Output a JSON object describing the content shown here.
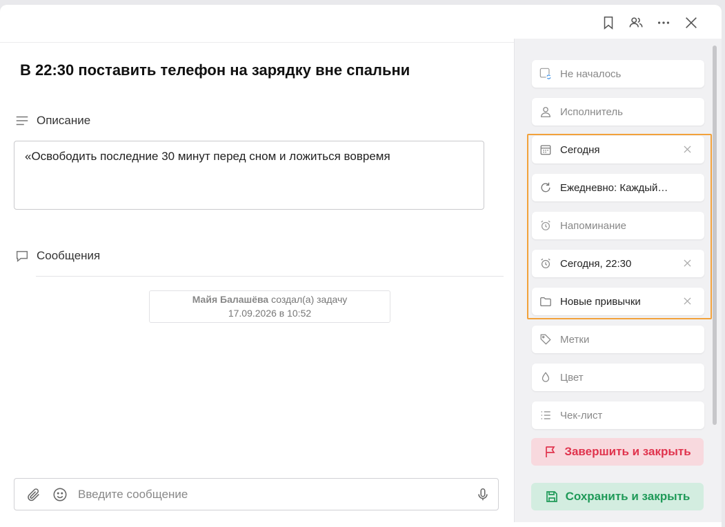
{
  "task": {
    "title": "В 22:30 поставить телефон на зарядку вне спальни"
  },
  "description": {
    "label": "Описание",
    "text": "«Освободить последние 30 минут перед сном и ложиться вовремя"
  },
  "messages": {
    "label": "Сообщения",
    "system_author": "Майя Балашёва",
    "system_action": "создал(а) задачу",
    "system_time": "17.09.2026 в 10:52",
    "input_placeholder": "Введите сообщение"
  },
  "sidebar": {
    "status": "Не началось",
    "assignee": "Исполнитель",
    "date": "Сегодня",
    "repeat": "Ежедневно: Каждый…",
    "reminder": "Напоминание",
    "reminder_set": "Сегодня, 22:30",
    "project": "Новые привычки",
    "tags": "Метки",
    "color": "Цвет",
    "checklist": "Чек-лист",
    "finish_button": "Завершить и закрыть",
    "save_button": "Сохранить и закрыть"
  },
  "colors": {
    "highlight": "#f2a13a",
    "finish": "#e0334d",
    "save": "#1f9a58"
  }
}
